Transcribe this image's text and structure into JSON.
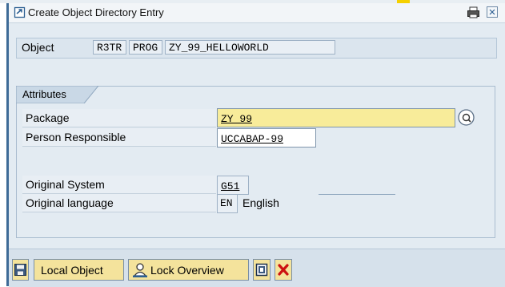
{
  "window": {
    "title": "Create Object Directory Entry"
  },
  "object": {
    "label": "Object",
    "pgmid": "R3TR",
    "type": "PROG",
    "name": "ZY_99_HELLOWORLD"
  },
  "attributes": {
    "group_title": "Attributes",
    "package": {
      "label": "Package",
      "value": "ZY_99"
    },
    "person_responsible": {
      "label": "Person Responsible",
      "value": "UCCABAP-99"
    },
    "original_system": {
      "label": "Original System",
      "value": "G51"
    },
    "original_language": {
      "label": "Original language",
      "code": "EN",
      "name": "English"
    }
  },
  "toolbar": {
    "local_object_label": "Local Object",
    "lock_overview_label": "Lock Overview"
  },
  "colors": {
    "accent_blue": "#3e6b97",
    "field_yellow": "#f8ec9a",
    "button_yellow": "#f4e39c",
    "cancel_red": "#cc1111"
  },
  "icons": {
    "title": "create-entry-icon",
    "print": "print-icon",
    "close": "close-icon",
    "help": "value-help-icon",
    "save": "save-icon",
    "lock": "lock-overview-icon",
    "info": "info-icon",
    "cancel": "cancel-icon"
  }
}
